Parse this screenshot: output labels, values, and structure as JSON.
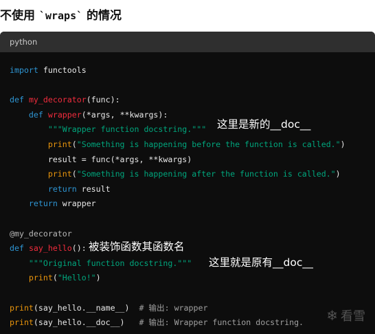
{
  "heading": {
    "prefix": "不使用 ",
    "code": "`wraps`",
    "suffix": " 的情况"
  },
  "code_block": {
    "language": "python",
    "lines": [
      [
        {
          "t": "import",
          "c": "kw"
        },
        {
          "t": " functools",
          "c": ""
        }
      ],
      [],
      [
        {
          "t": "def",
          "c": "kw"
        },
        {
          "t": " ",
          "c": ""
        },
        {
          "t": "my_decorator",
          "c": "fn"
        },
        {
          "t": "(func):",
          "c": ""
        }
      ],
      [
        {
          "t": "    ",
          "c": ""
        },
        {
          "t": "def",
          "c": "kw"
        },
        {
          "t": " ",
          "c": ""
        },
        {
          "t": "wrapper",
          "c": "fn"
        },
        {
          "t": "(*args, **kwargs):",
          "c": ""
        }
      ],
      [
        {
          "t": "        ",
          "c": ""
        },
        {
          "t": "\"\"\"Wrapper function docstring.\"\"\"",
          "c": "str"
        }
      ],
      [
        {
          "t": "        ",
          "c": ""
        },
        {
          "t": "print",
          "c": "bi"
        },
        {
          "t": "(",
          "c": ""
        },
        {
          "t": "\"Something is happening before the function is called.\"",
          "c": "str"
        },
        {
          "t": ")",
          "c": ""
        }
      ],
      [
        {
          "t": "        result = func(*args, **kwargs)",
          "c": ""
        }
      ],
      [
        {
          "t": "        ",
          "c": ""
        },
        {
          "t": "print",
          "c": "bi"
        },
        {
          "t": "(",
          "c": ""
        },
        {
          "t": "\"Something is happening after the function is called.\"",
          "c": "str"
        },
        {
          "t": ")",
          "c": ""
        }
      ],
      [
        {
          "t": "        ",
          "c": ""
        },
        {
          "t": "return",
          "c": "kw"
        },
        {
          "t": " result",
          "c": ""
        }
      ],
      [
        {
          "t": "    ",
          "c": ""
        },
        {
          "t": "return",
          "c": "kw"
        },
        {
          "t": " wrapper",
          "c": ""
        }
      ],
      [],
      [
        {
          "t": "@my_decorator",
          "c": "deco"
        }
      ],
      [
        {
          "t": "def",
          "c": "kw"
        },
        {
          "t": " ",
          "c": ""
        },
        {
          "t": "say_hello",
          "c": "fn"
        },
        {
          "t": "():",
          "c": ""
        }
      ],
      [
        {
          "t": "    ",
          "c": ""
        },
        {
          "t": "\"\"\"Original function docstring.\"\"\"",
          "c": "str"
        }
      ],
      [
        {
          "t": "    ",
          "c": ""
        },
        {
          "t": "print",
          "c": "bi"
        },
        {
          "t": "(",
          "c": ""
        },
        {
          "t": "\"Hello!\"",
          "c": "str"
        },
        {
          "t": ")",
          "c": ""
        }
      ],
      [],
      [
        {
          "t": "print",
          "c": "bi"
        },
        {
          "t": "(say_hello.__name__)  ",
          "c": ""
        },
        {
          "t": "# 输出: wrapper",
          "c": "cm"
        }
      ],
      [
        {
          "t": "print",
          "c": "bi"
        },
        {
          "t": "(say_hello.__doc__)   ",
          "c": ""
        },
        {
          "t": "# 输出: Wrapper function docstring.",
          "c": "cm"
        }
      ]
    ]
  },
  "annotations": {
    "new_doc": "这里是新的__doc__",
    "decorated_name": "被装饰函数其函数名",
    "original_doc": "这里就是原有__doc__"
  },
  "watermark": {
    "icon": "snowflake-icon",
    "text": "看雪"
  }
}
